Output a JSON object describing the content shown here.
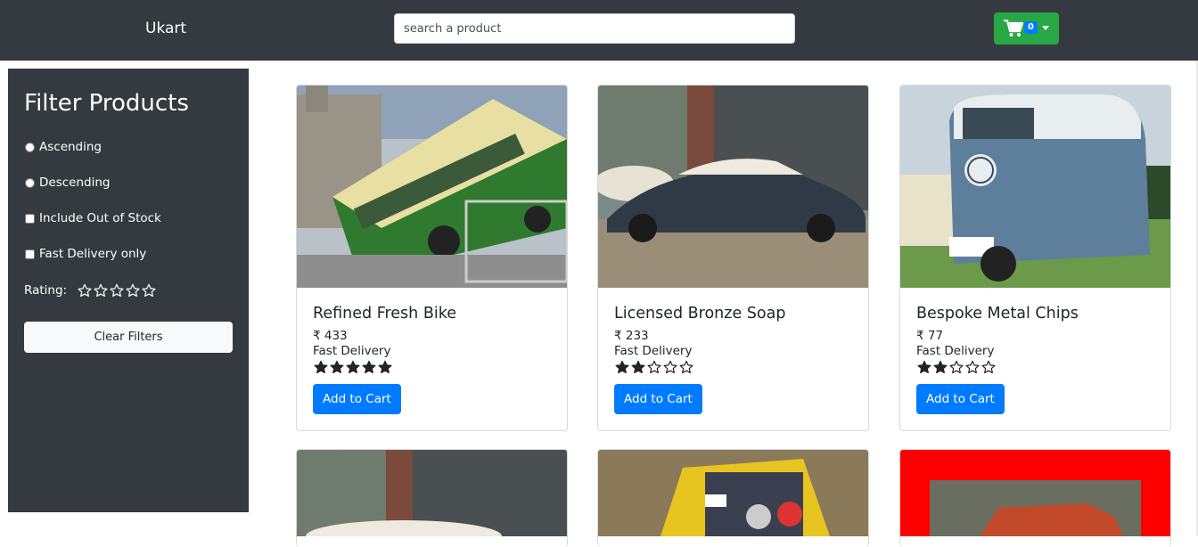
{
  "navbar": {
    "brand": "Ukart",
    "search_placeholder": "search a product",
    "cart_count": "0",
    "cart_icon": "shopping-cart-icon",
    "colors": {
      "bg": "#343a40",
      "cart_button": "#28a745",
      "badge": "#007bff"
    }
  },
  "sidebar": {
    "title": "Filter Products",
    "options": {
      "ascending": "Ascending",
      "descending": "Descending",
      "out_of_stock": "Include Out of Stock",
      "fast_delivery": "Fast Delivery only"
    },
    "rating_label": "Rating:",
    "rating_value": 0,
    "clear_label": "Clear Filters"
  },
  "products": [
    {
      "title": "Refined Fresh Bike",
      "price": "₹ 433",
      "delivery": "Fast Delivery",
      "rating": 5,
      "button": "Add to Cart",
      "image": "green-bus-photo"
    },
    {
      "title": "Licensed Bronze Soap",
      "price": "₹ 233",
      "delivery": "Fast Delivery",
      "rating": 2,
      "button": "Add to Cart",
      "image": "classic-car-photo"
    },
    {
      "title": "Bespoke Metal Chips",
      "price": "₹ 77",
      "delivery": "Fast Delivery",
      "rating": 2,
      "button": "Add to Cart",
      "image": "vw-van-photo"
    }
  ],
  "partial_products": [
    {
      "image": "classic-car-photo"
    },
    {
      "image": "rally-car-photo"
    },
    {
      "image": "red-suv-photo"
    }
  ],
  "colors": {
    "accent": "#007bff",
    "dark": "#343a40"
  }
}
